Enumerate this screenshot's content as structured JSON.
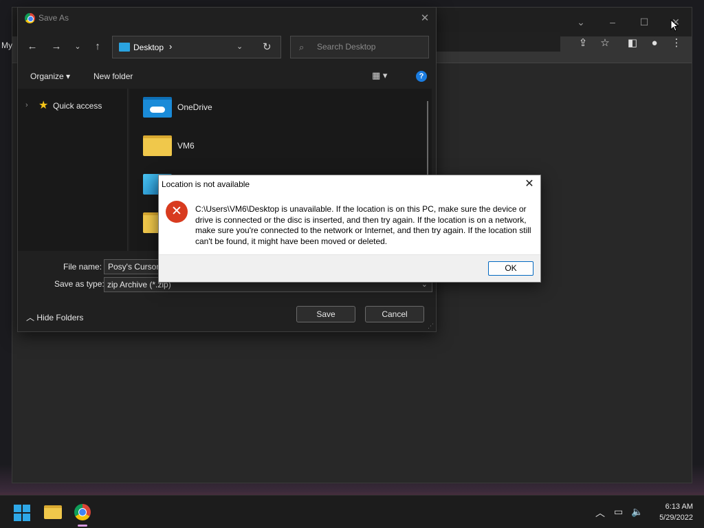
{
  "browser": {
    "tab_text": "My",
    "window_controls": {
      "dropdown": "⌄",
      "minimize": "–",
      "maximize": "☐",
      "close": "✕"
    }
  },
  "save_dialog": {
    "title": "Save As",
    "address": {
      "location": "Desktop"
    },
    "search": {
      "placeholder": "Search Desktop"
    },
    "toolbar": {
      "organize": "Organize ▾",
      "new_folder": "New folder"
    },
    "nav_pane": {
      "quick_access": "Quick access"
    },
    "files": [
      {
        "name": "OneDrive",
        "icon": "onedrive-folder-icon"
      },
      {
        "name": "VM6",
        "icon": "folder-icon"
      },
      {
        "name": "",
        "icon": "monitor-icon"
      },
      {
        "name": "",
        "icon": "folder-icon"
      }
    ],
    "file_name_label": "File name:",
    "file_name_value": "Posy's Cursor",
    "save_as_type_label": "Save as type:",
    "save_as_type_value": "zip Archive (*.zip)",
    "hide_folders": "Hide Folders",
    "save_button": "Save",
    "cancel_button": "Cancel"
  },
  "error_dialog": {
    "title": "Location is not available",
    "message": "C:\\Users\\VM6\\Desktop is unavailable. If the location is on this PC, make sure the device or drive is connected or the disc is inserted, and then try again. If the location is on a network, make sure you're connected to the network or Internet, and then try again. If the location still can't be found, it might have been moved or deleted.",
    "ok_button": "OK"
  },
  "taskbar": {
    "time": "6:13 AM",
    "date": "5/29/2022"
  }
}
